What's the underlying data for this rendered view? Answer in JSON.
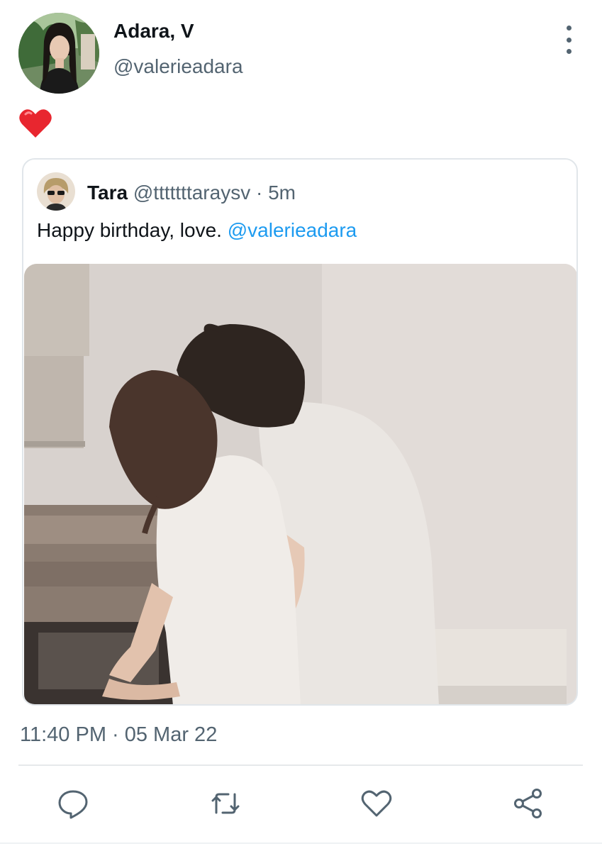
{
  "tweet": {
    "author_name": "Adara, V",
    "author_handle": "@valerieadara",
    "emoji": "heart",
    "timestamp": "11:40 PM · 05 Mar 22"
  },
  "quoted_tweet": {
    "author_name": "Tara",
    "author_handle": "@tttttttaraysv",
    "separator": " · ",
    "time_ago": "5m",
    "text": "Happy birthday, love. ",
    "mention": "@valerieadara"
  },
  "actions": [
    "reply-icon",
    "retweet-icon",
    "like-icon",
    "share-icon"
  ],
  "colors": {
    "mention": "#1d9bf0",
    "secondary_text": "#536471",
    "heart": "#e8262f"
  }
}
